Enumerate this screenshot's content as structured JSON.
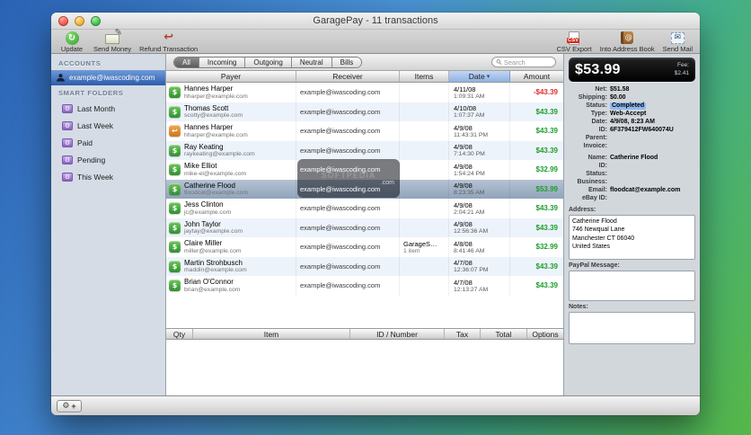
{
  "window": {
    "title": "GaragePay - 11 transactions"
  },
  "toolbar": {
    "update": "Update",
    "send_money": "Send Money",
    "refund": "Refund Transaction",
    "csv_export": "CSV Export",
    "address_book": "Into Address Book",
    "send_mail": "Send Mail"
  },
  "icons": {
    "update": "↻",
    "pencil": "✎",
    "refund": "↩",
    "csv_badge": "CSV",
    "book_at": "@",
    "mail": "✉",
    "folder_gear": "⚙",
    "sort_arrow": "▾",
    "gear_menu": "⚙",
    "add": "+"
  },
  "sidebar": {
    "accounts_header": "ACCOUNTS",
    "account": "example@iwascoding.com",
    "smart_folders_header": "SMART FOLDERS",
    "folders": [
      "Last Month",
      "Last Week",
      "Paid",
      "Pending",
      "This Week"
    ]
  },
  "filters": {
    "tabs": [
      {
        "label": "All",
        "state": "selected"
      },
      {
        "label": "Incoming",
        "state": ""
      },
      {
        "label": "Outgoing",
        "state": ""
      },
      {
        "label": "Neutral",
        "state": ""
      },
      {
        "label": "Bills",
        "state": ""
      }
    ],
    "search_placeholder": "Search"
  },
  "transactions": {
    "columns": {
      "payer": "Payer",
      "receiver": "Receiver",
      "items": "Items",
      "date": "Date",
      "amount": "Amount"
    },
    "rows": [
      {
        "icon": "green",
        "icon_glyph": "$",
        "payer_name": "Hannes Harper",
        "payer_email": "hharper@example.com",
        "receiver": "example@iwascoding.com",
        "receiver_class": "",
        "item_name": "",
        "item_count": "",
        "date": "4/11/08",
        "time": "1:09:31 AM",
        "amount": "-$43.39",
        "amount_class": "neg",
        "row_class": ""
      },
      {
        "icon": "green",
        "icon_glyph": "$",
        "payer_name": "Thomas Scott",
        "payer_email": "scotty@example.com",
        "receiver": "example@iwascoding.com",
        "receiver_class": "",
        "item_name": "",
        "item_count": "",
        "date": "4/10/08",
        "time": "1:07:37 AM",
        "amount": "$43.39",
        "amount_class": "pos",
        "row_class": ""
      },
      {
        "icon": "orange",
        "icon_glyph": "↩",
        "payer_name": "Hannes Harper",
        "payer_email": "hharper@example.com",
        "receiver": "example@iwascoding.com",
        "receiver_class": "",
        "item_name": "",
        "item_count": "",
        "date": "4/9/08",
        "time": "11:43:31 PM",
        "amount": "$43.39",
        "amount_class": "pos",
        "row_class": ""
      },
      {
        "icon": "green",
        "icon_glyph": "$",
        "payer_name": "Ray Keating",
        "payer_email": "raykeating@example.com",
        "receiver": "example@iwascoding.com",
        "receiver_class": "",
        "item_name": "",
        "item_count": "",
        "date": "4/9/08",
        "time": "7:14:30 PM",
        "amount": "$43.39",
        "amount_class": "pos",
        "row_class": ""
      },
      {
        "icon": "green",
        "icon_glyph": "$",
        "payer_name": "Mike Elliot",
        "payer_email": "mike-el@example.com",
        "receiver": "example@iwascoding.com",
        "receiver_class": "wm",
        "item_name": "",
        "item_count": "",
        "date": "4/9/08",
        "time": "1:54:24 PM",
        "amount": "$32.99",
        "amount_class": "pos",
        "row_class": ""
      },
      {
        "icon": "green",
        "icon_glyph": "$",
        "payer_name": "Catherine Flood",
        "payer_email": "floodcat@example.com",
        "receiver": "example@iwascoding.com",
        "receiver_class": "wm",
        "item_name": "",
        "item_count": "",
        "date": "4/9/08",
        "time": "8:23:35 AM",
        "amount": "$53.99",
        "amount_class": "pos",
        "row_class": "selected"
      },
      {
        "icon": "green",
        "icon_glyph": "$",
        "payer_name": "Jess Clinton",
        "payer_email": "jc@example.com",
        "receiver": "example@iwascoding.com",
        "receiver_class": "",
        "item_name": "",
        "item_count": "",
        "date": "4/9/08",
        "time": "2:04:21 AM",
        "amount": "$43.39",
        "amount_class": "pos",
        "row_class": ""
      },
      {
        "icon": "green",
        "icon_glyph": "$",
        "payer_name": "John Taylor",
        "payer_email": "jaytay@example.com",
        "receiver": "example@iwascoding.com",
        "receiver_class": "",
        "item_name": "",
        "item_count": "",
        "date": "4/9/08",
        "time": "12:56:36 AM",
        "amount": "$43.39",
        "amount_class": "pos",
        "row_class": ""
      },
      {
        "icon": "green",
        "icon_glyph": "$",
        "payer_name": "Claire Miller",
        "payer_email": "miller@example.com",
        "receiver": "example@iwascoding.com",
        "receiver_class": "",
        "item_name": "GarageS…",
        "item_count": "1 item",
        "date": "4/8/08",
        "time": "8:41:46 AM",
        "amount": "$32.99",
        "amount_class": "pos",
        "row_class": ""
      },
      {
        "icon": "green",
        "icon_glyph": "$",
        "payer_name": "Martin Strohbusch",
        "payer_email": "maddin@example.com",
        "receiver": "example@iwascoding.com",
        "receiver_class": "",
        "item_name": "",
        "item_count": "",
        "date": "4/7/08",
        "time": "12:36:07 PM",
        "amount": "$43.39",
        "amount_class": "pos",
        "row_class": ""
      },
      {
        "icon": "green",
        "icon_glyph": "$",
        "payer_name": "Brian O'Connor",
        "payer_email": "brian@example.com",
        "receiver": "example@iwascoding.com",
        "receiver_class": "",
        "item_name": "",
        "item_count": "",
        "date": "4/7/08",
        "time": "12:13:27 AM",
        "amount": "$43.39",
        "amount_class": "pos",
        "row_class": ""
      }
    ]
  },
  "watermark": {
    "line1": "SOFTPEDIA",
    "line2": ".com"
  },
  "items_table": {
    "columns": [
      "Qty",
      "Item",
      "ID / Number",
      "Tax",
      "Total",
      "Options"
    ]
  },
  "details": {
    "amount": "$53.99",
    "fee_label": "Fee:",
    "fee": "$2.41",
    "transaction_fields": [
      {
        "label": "Net:",
        "value": "$51.58",
        "value_class": ""
      },
      {
        "label": "Shipping:",
        "value": "$0.00",
        "value_class": ""
      },
      {
        "label": "Status:",
        "value": "Completed",
        "value_class": "highlight"
      },
      {
        "label": "Type:",
        "value": "Web-Accept",
        "value_class": ""
      },
      {
        "label": "Date:",
        "value": "4/9/08, 8:23 AM",
        "value_class": ""
      },
      {
        "label": "ID:",
        "value": "6F379412FW640074U",
        "value_class": ""
      },
      {
        "label": "Parent:",
        "value": "",
        "value_class": ""
      },
      {
        "label": "Invoice:",
        "value": "",
        "value_class": ""
      }
    ],
    "payer_fields": [
      {
        "label": "Name:",
        "value": "Catherine Flood",
        "value_class": ""
      },
      {
        "label": "ID:",
        "value": "",
        "value_class": ""
      },
      {
        "label": "Status:",
        "value": "",
        "value_class": ""
      },
      {
        "label": "Business:",
        "value": "",
        "value_class": ""
      },
      {
        "label": "Email:",
        "value": "floodcat@example.com",
        "value_class": ""
      },
      {
        "label": "eBay ID:",
        "value": "",
        "value_class": ""
      }
    ],
    "address_label": "Address:",
    "address_lines": [
      "Catherine Flood",
      "746 Newqual Lane",
      "Manchester CT 06040",
      "United States"
    ],
    "paypal_message_label": "PayPal Message:",
    "notes_label": "Notes:"
  }
}
